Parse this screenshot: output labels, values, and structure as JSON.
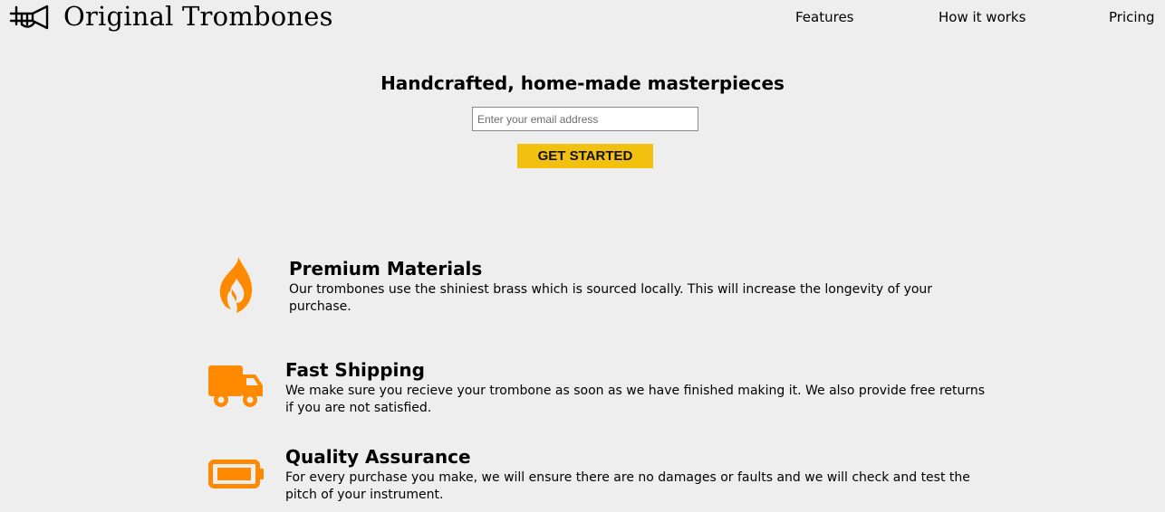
{
  "header": {
    "brand_name": "Original Trombones",
    "logo_icon": "trombone-icon",
    "nav": [
      {
        "label": "Features"
      },
      {
        "label": "How it works"
      },
      {
        "label": "Pricing"
      }
    ]
  },
  "hero": {
    "title": "Handcrafted, home-made masterpieces",
    "email_placeholder": "Enter your email address",
    "cta_label": "GET STARTED"
  },
  "features": [
    {
      "icon": "fire-icon",
      "title": "Premium Materials",
      "description": "Our trombones use the shiniest brass which is sourced locally. This will increase the longevity of your purchase."
    },
    {
      "icon": "truck-icon",
      "title": "Fast Shipping",
      "description": "We make sure you recieve your trombone as soon as we have finished making it. We also provide free returns if you are not satisfied."
    },
    {
      "icon": "battery-icon",
      "title": "Quality Assurance",
      "description": "For every purchase you make, we will ensure there are no damages or faults and we will check and test the pitch of your instrument."
    }
  ],
  "colors": {
    "background": "#eeeeee",
    "accent": "#f2c00f",
    "icon": "#ff8a00"
  }
}
